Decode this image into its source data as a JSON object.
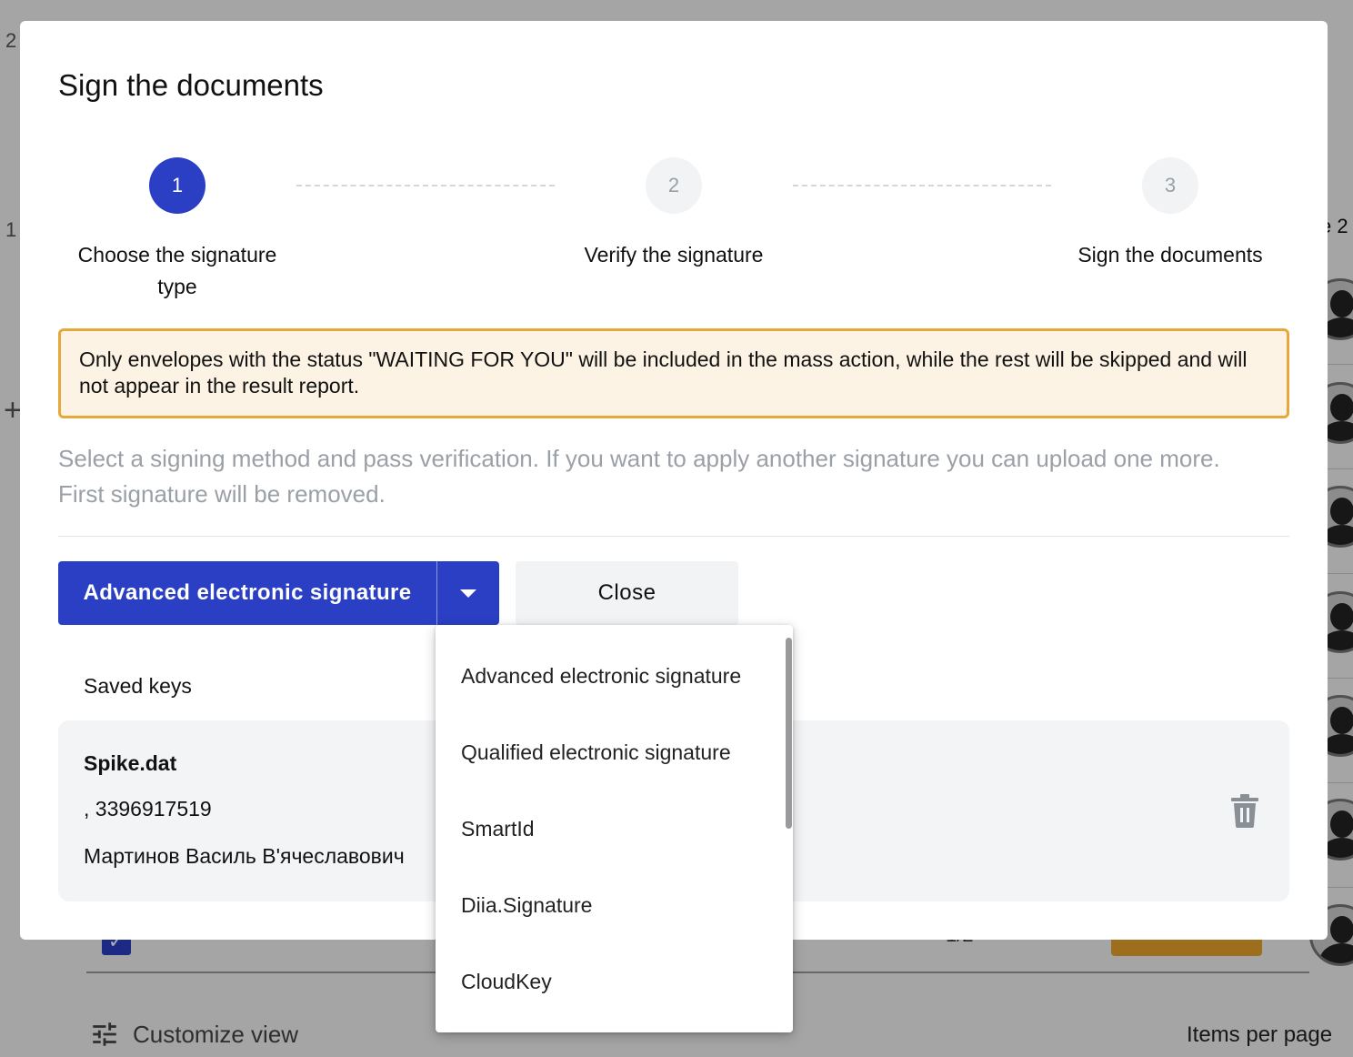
{
  "modal": {
    "title": "Sign the documents",
    "steps": [
      {
        "number": "1",
        "label": "Choose the signature type",
        "active": true
      },
      {
        "number": "2",
        "label": "Verify the signature",
        "active": false
      },
      {
        "number": "3",
        "label": "Sign the documents",
        "active": false
      }
    ],
    "warning": "Only envelopes with the status \"WAITING FOR YOU\" will be included in the mass action, while the rest will be skipped and will not appear in the result report.",
    "hint": "Select a signing method and pass verification. If you want to apply another signature you can upload one more. First signature will be removed.",
    "signature_button": {
      "label": "Advanced electronic signature",
      "arrow_icon": "caret-down-icon"
    },
    "close_button": "Close",
    "saved_keys_label": "Saved keys",
    "key": {
      "name": "Spike.dat",
      "id_line": ", 3396917519",
      "owner": "Мартинов Василь В'ячеславович",
      "delete_icon": "trash-icon"
    }
  },
  "dropdown": {
    "items": [
      "Advanced electronic signature",
      "Qualified electronic signature",
      "SmartId",
      "Diia.Signature",
      "CloudKey"
    ]
  },
  "background": {
    "frag_a": "2",
    "frag_b": "1",
    "frag_c": "e 2",
    "pager": "1/2",
    "customize_view": "Customize view",
    "items_per_page": "Items per page"
  },
  "colors": {
    "primary": "#2a3fc4",
    "warning_border": "#e6a83a",
    "warning_bg": "#fdf3e4",
    "hint_text": "#9aa0a6"
  }
}
